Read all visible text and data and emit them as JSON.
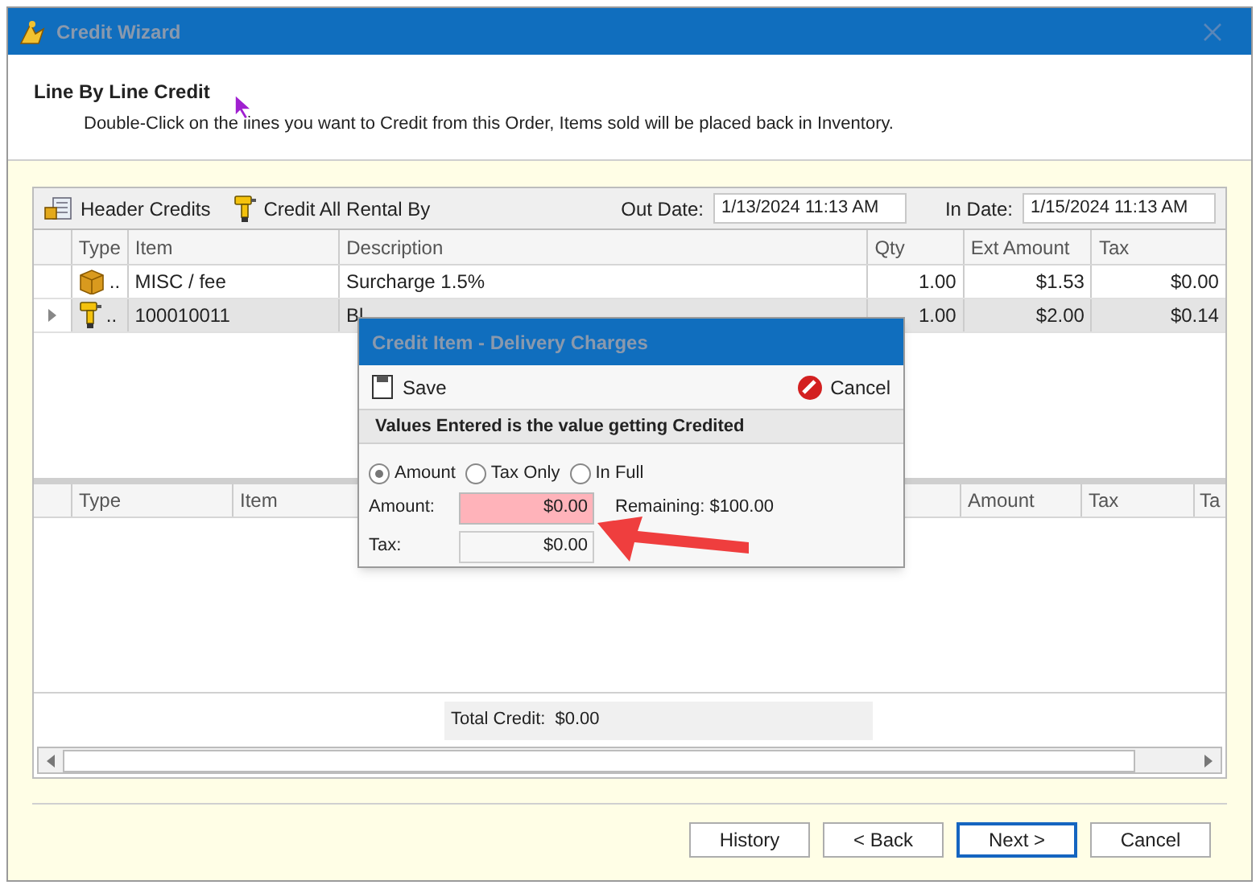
{
  "window": {
    "title": "Credit Wizard"
  },
  "header": {
    "title": "Line By Line Credit",
    "instruction": "Double-Click on the lines you want to Credit from this Order, Items sold will be placed back in Inventory."
  },
  "toolbar": {
    "buttons": [
      {
        "label": "Header Credits",
        "kind": "header"
      },
      {
        "label": "Credit All Rental By",
        "kind": "drill"
      }
    ],
    "dates": [
      {
        "label": "Out Date:",
        "value": "1/13/2024 11:13 AM"
      },
      {
        "label": "In Date:",
        "value": "1/15/2024 11:13 AM"
      }
    ]
  },
  "grid": {
    "columns": [
      "Type",
      "Item",
      "Description",
      "Qty",
      "Ext Amount",
      "Tax"
    ],
    "rows": [
      {
        "kind": "box",
        "type": "..",
        "item": "MISC / fee",
        "description": "Surcharge 1.5%",
        "qty": "1.00",
        "ext_amount": "$1.53",
        "tax": "$0.00",
        "selected": false
      },
      {
        "kind": "drill",
        "type": "..",
        "item": "100010011",
        "description": "Bl",
        "qty": "1.00",
        "ext_amount": "$2.00",
        "tax": "$0.14",
        "selected": true
      }
    ]
  },
  "credit_grid": {
    "columns": [
      "Type",
      "Item",
      "Amount",
      "Tax",
      "Ta"
    ],
    "total_label": "Total Credit:",
    "total_value": "$0.00"
  },
  "dialog": {
    "title": "Credit Item - Delivery Charges",
    "save": "Save",
    "cancel": "Cancel",
    "banner": "Values Entered is the value getting Credited",
    "options": [
      {
        "label": "Amount",
        "selected": true
      },
      {
        "label": "Tax Only",
        "selected": false
      },
      {
        "label": "In Full",
        "selected": false
      }
    ],
    "amount_label": "Amount:",
    "amount_value": "$0.00",
    "remaining": "Remaining: $100.00",
    "tax_label": "Tax:",
    "tax_value": "$0.00"
  },
  "footer": {
    "buttons": [
      {
        "label": "History",
        "default": false
      },
      {
        "label": "< Back",
        "default": false
      },
      {
        "label": "Next >",
        "default": true
      },
      {
        "label": "Cancel",
        "default": false
      }
    ]
  }
}
